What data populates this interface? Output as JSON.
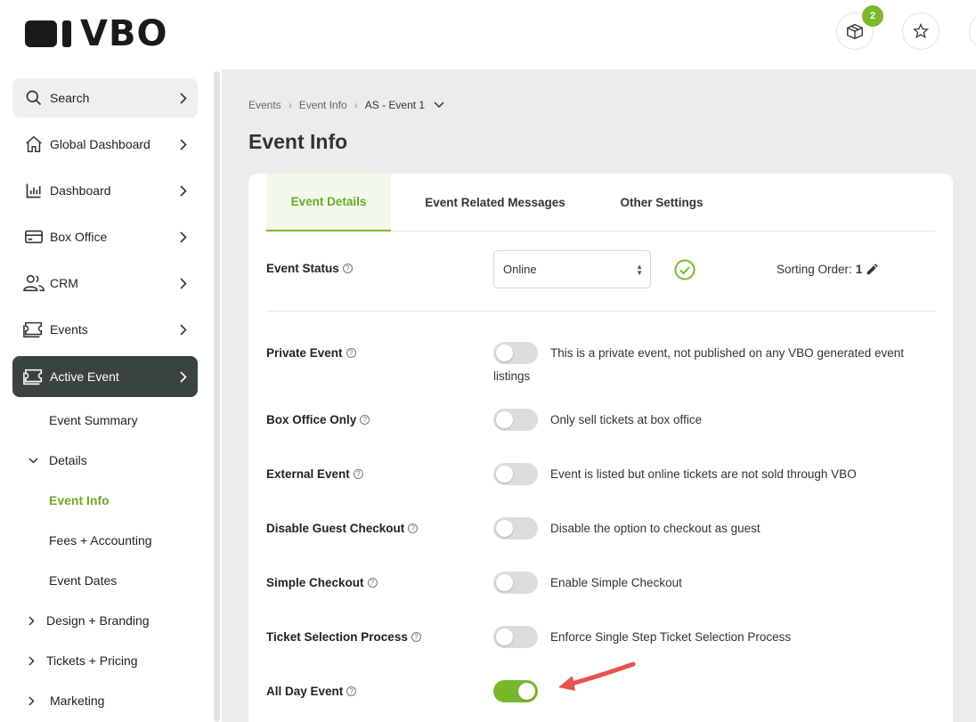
{
  "header": {
    "logo_text": "VBO",
    "cart_badge": "2",
    "brand_color": "#7cb82f"
  },
  "sidebar": {
    "items": [
      {
        "label": "Search",
        "icon": "search-icon"
      },
      {
        "label": "Global Dashboard",
        "icon": "home-icon"
      },
      {
        "label": "Dashboard",
        "icon": "bar-chart-icon"
      },
      {
        "label": "Box Office",
        "icon": "credit-card-icon"
      },
      {
        "label": "CRM",
        "icon": "users-icon"
      },
      {
        "label": "Events",
        "icon": "ticket-icon"
      },
      {
        "label": "Active Event",
        "icon": "ticket-icon"
      }
    ],
    "sub_items": {
      "event_summary": "Event Summary",
      "details": "Details",
      "event_info": "Event Info",
      "fees_accounting": "Fees + Accounting",
      "event_dates": "Event Dates",
      "design_branding": "Design + Branding",
      "tickets_pricing": "Tickets + Pricing",
      "marketing": "Marketing"
    }
  },
  "breadcrumb": {
    "items": [
      "Events",
      "Event Info",
      "AS - Event 1"
    ]
  },
  "page": {
    "title": "Event Info"
  },
  "tabs": [
    "Event Details",
    "Event Related Messages",
    "Other Settings"
  ],
  "event_status": {
    "label": "Event Status",
    "help": "?",
    "value": "Online",
    "sorting_label": "Sorting Order:",
    "sorting_value": "1"
  },
  "settings": [
    {
      "label": "Private Event",
      "description": "This is a private event, not published on any VBO generated event listings",
      "enabled": false
    },
    {
      "label": "Box Office Only",
      "description": "Only sell tickets at box office",
      "enabled": false
    },
    {
      "label": "External Event",
      "description": "Event is listed but online tickets are not sold through VBO",
      "enabled": false
    },
    {
      "label": "Disable Guest Checkout",
      "description": "Disable the option to checkout as guest",
      "enabled": false
    },
    {
      "label": "Simple Checkout",
      "description": "Enable Simple Checkout",
      "enabled": false
    },
    {
      "label": "Ticket Selection Process",
      "description": "Enforce Single Step Ticket Selection Process",
      "enabled": false
    },
    {
      "label": "All Day Event",
      "description": "",
      "enabled": true
    }
  ],
  "colors": {
    "accent": "#6aab24",
    "active_nav_bg": "#3b4242",
    "toggle_on": "#76b82a",
    "annotation_arrow": "#e9534d"
  }
}
